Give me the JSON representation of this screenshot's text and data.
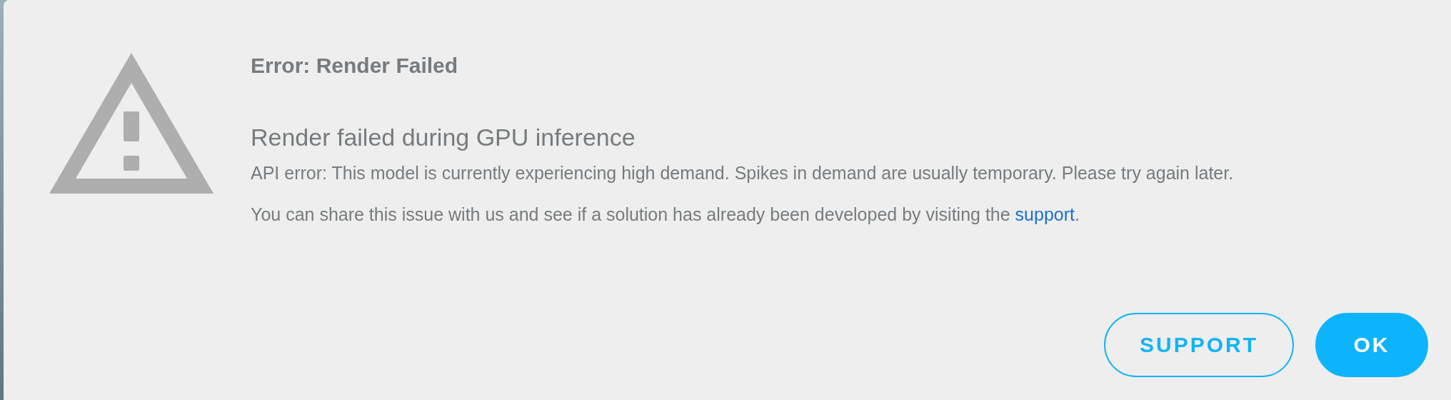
{
  "dialog": {
    "title": "Error: Render Failed",
    "heading": "Render failed during GPU inference",
    "message": "API error: This model is currently experiencing high demand. Spikes in demand are usually temporary. Please try again later.",
    "help": {
      "text_before": "You can share this issue with us and see if a solution has already been developed by visiting the ",
      "link": "support",
      "text_after": "."
    },
    "buttons": [
      {
        "label": "SUPPORT",
        "kind": "outlined"
      },
      {
        "label": "OK",
        "kind": "filled"
      }
    ]
  }
}
